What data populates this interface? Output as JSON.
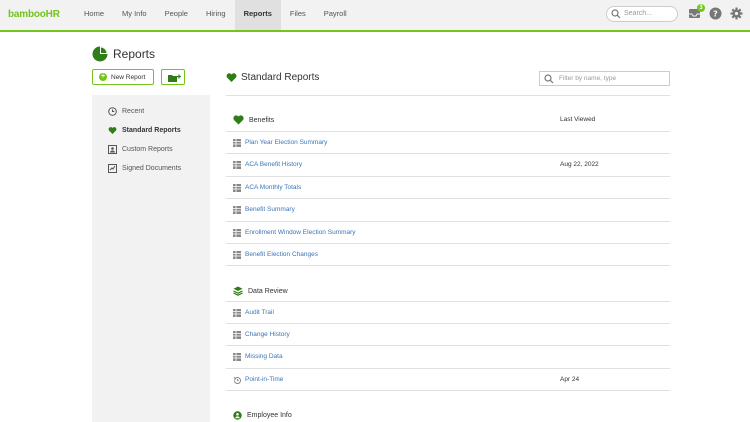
{
  "app": {
    "logo": "bambooHR"
  },
  "nav": {
    "items": [
      "Home",
      "My Info",
      "People",
      "Hiring",
      "Reports",
      "Files",
      "Payroll"
    ],
    "active": "Reports"
  },
  "search": {
    "placeholder": "Search..."
  },
  "notifications": {
    "count": "3"
  },
  "page": {
    "title": "Reports"
  },
  "actions": {
    "new_report": "New Report"
  },
  "sidebar": {
    "items": [
      {
        "label": "Recent",
        "icon": "recent-icon"
      },
      {
        "label": "Standard Reports",
        "icon": "standard-reports-icon",
        "active": true
      },
      {
        "label": "Custom Reports",
        "icon": "custom-reports-icon"
      },
      {
        "label": "Signed Documents",
        "icon": "signed-documents-icon"
      }
    ]
  },
  "main": {
    "title": "Standard Reports",
    "filter_placeholder": "Filter by name, type",
    "last_viewed_header": "Last Viewed",
    "sections": [
      {
        "name": "Benefits",
        "icon": "heart-icon",
        "rows": [
          {
            "name": "Plan Year Election Summary",
            "last_viewed": ""
          },
          {
            "name": "ACA Benefit History",
            "last_viewed": "Aug 22, 2022"
          },
          {
            "name": "ACA Monthly Totals",
            "last_viewed": ""
          },
          {
            "name": "Benefit Summary",
            "last_viewed": ""
          },
          {
            "name": "Enrollment Window Election Summary",
            "last_viewed": ""
          },
          {
            "name": "Benefit Election Changes",
            "last_viewed": ""
          }
        ]
      },
      {
        "name": "Data Review",
        "icon": "layers-icon",
        "rows": [
          {
            "name": "Audit Trail",
            "last_viewed": "",
            "icon": "table-icon"
          },
          {
            "name": "Change History",
            "last_viewed": "",
            "icon": "table-icon"
          },
          {
            "name": "Missing Data",
            "last_viewed": "",
            "icon": "table-icon"
          },
          {
            "name": "Point-in-Time",
            "last_viewed": "Apr 24",
            "icon": "history-icon"
          }
        ]
      },
      {
        "name": "Employee Info",
        "icon": "person-icon",
        "rows": []
      }
    ]
  },
  "colors": {
    "brand": "#73c41d",
    "link": "#3b75b8"
  }
}
